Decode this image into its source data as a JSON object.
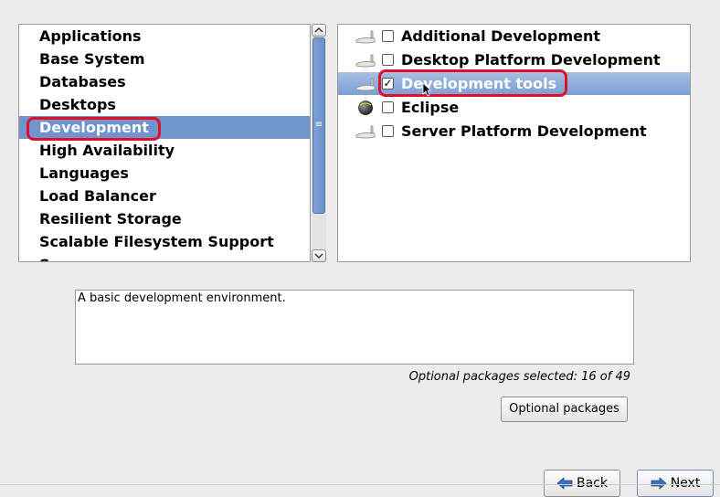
{
  "categories": {
    "items": [
      {
        "label": "Applications"
      },
      {
        "label": "Base System"
      },
      {
        "label": "Databases"
      },
      {
        "label": "Desktops"
      },
      {
        "label": "Development"
      },
      {
        "label": "High Availability"
      },
      {
        "label": "Languages"
      },
      {
        "label": "Load Balancer"
      },
      {
        "label": "Resilient Storage"
      },
      {
        "label": "Scalable Filesystem Support"
      },
      {
        "label": "Servers"
      }
    ],
    "selected_label": "Development"
  },
  "groups": {
    "items": [
      {
        "label": "Additional Development",
        "checked": false,
        "icon": "package-icon"
      },
      {
        "label": "Desktop Platform Development",
        "checked": false,
        "icon": "package-icon"
      },
      {
        "label": "Development tools",
        "checked": true,
        "icon": "package-icon"
      },
      {
        "label": "Eclipse",
        "checked": false,
        "icon": "eclipse-icon"
      },
      {
        "label": "Server Platform Development",
        "checked": false,
        "icon": "package-icon"
      }
    ],
    "selected_label": "Development tools"
  },
  "description": "A basic development environment.",
  "optional": {
    "status": "Optional packages selected: 16 of 49",
    "button_label": "Optional packages"
  },
  "nav": {
    "back_label": "Back",
    "next_label": "Next"
  },
  "colors": {
    "selection": "#6e95cc",
    "highlight_ring": "#e0102a",
    "window_bg": "#edeceb"
  }
}
